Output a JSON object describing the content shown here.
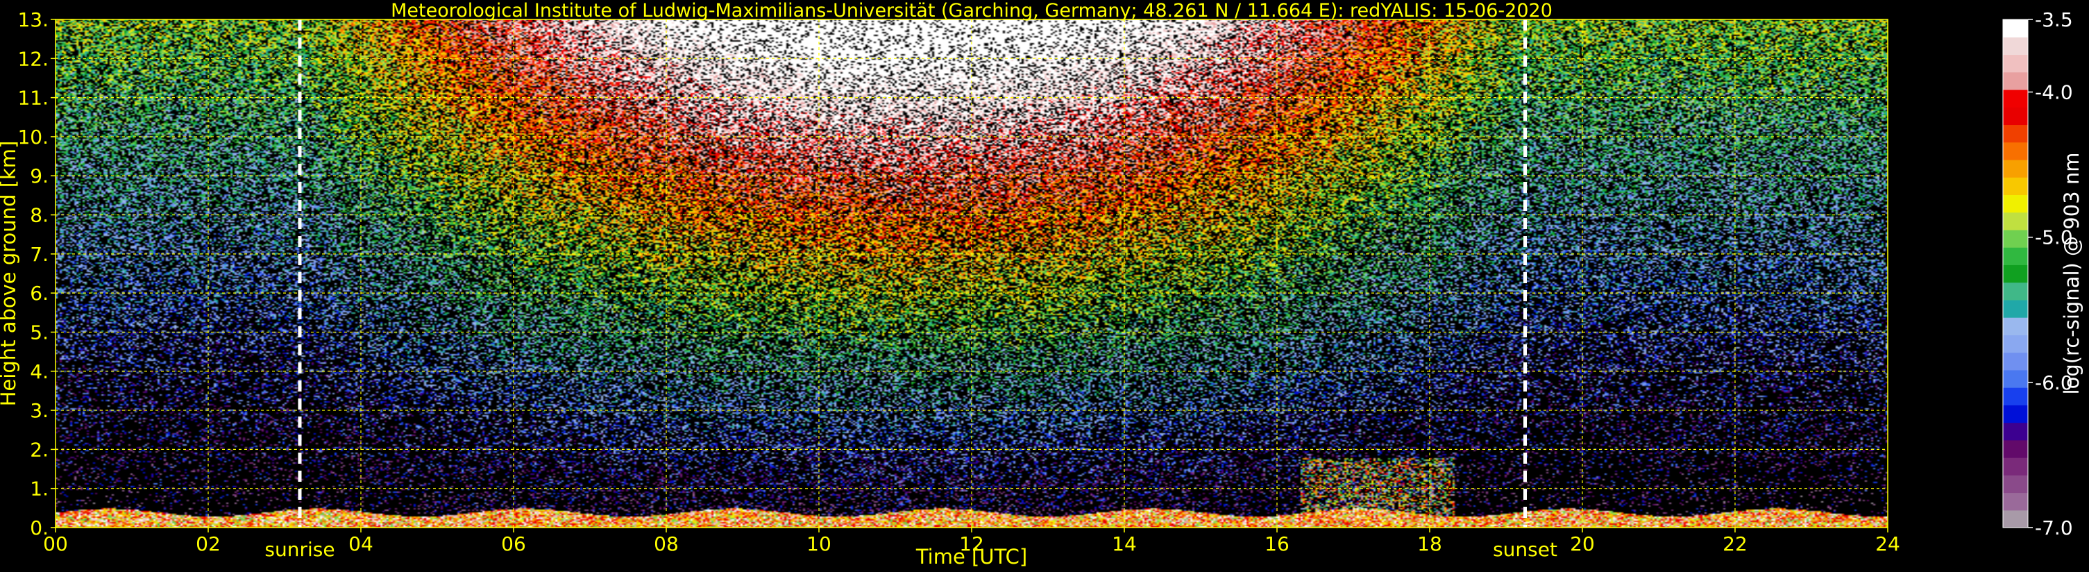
{
  "chart_data": {
    "type": "heatmap",
    "title": "Meteorological Institute of Ludwig-Maximilians-Universität (Garching, Germany; 48.261 N / 11.664 E):    redYALIS: 15-06-2020",
    "xlabel": "Time [UTC]",
    "ylabel": "Height above ground [km]",
    "xlim": [
      0,
      24
    ],
    "ylim": [
      0,
      13
    ],
    "x_ticks": [
      0,
      2,
      4,
      6,
      8,
      10,
      12,
      14,
      16,
      18,
      20,
      22,
      24
    ],
    "x_tick_labels": [
      "00",
      "02",
      "04",
      "06",
      "08",
      "10",
      "12",
      "14",
      "16",
      "18",
      "20",
      "22",
      "24"
    ],
    "y_ticks": [
      0,
      1,
      2,
      3,
      4,
      5,
      6,
      7,
      8,
      9,
      10,
      11,
      12,
      13
    ],
    "y_tick_labels": [
      "0.",
      "1.",
      "2.",
      "3.",
      "4.",
      "5.",
      "6.",
      "7.",
      "8.",
      "9.",
      "10.",
      "11.",
      "12.",
      "13."
    ],
    "grid": true,
    "events": [
      {
        "label": "sunrise",
        "x": 3.2
      },
      {
        "label": "sunset",
        "x": 19.25
      }
    ],
    "colorbar": {
      "label": "log(rc-signal) @ 903 nm",
      "range": [
        -7.0,
        -3.5
      ],
      "ticks": [
        -3.5,
        -4.0,
        -5.0,
        -6.0,
        -7.0
      ],
      "tick_labels": [
        "-3.5",
        "-4.0",
        "-5.0",
        "-6.0",
        "-7.0"
      ],
      "colors": [
        "#a89aa8",
        "#9a6a9a",
        "#8a4a8a",
        "#7a2a7a",
        "#620a6a",
        "#3c0090",
        "#0010d8",
        "#1840ee",
        "#4a78f0",
        "#7090f0",
        "#8aa8f0",
        "#9ab8ee",
        "#20a8a8",
        "#40b888",
        "#10a020",
        "#30b840",
        "#70d050",
        "#c0e040",
        "#f0f000",
        "#f8c800",
        "#f8a000",
        "#f87000",
        "#f04000",
        "#e80000",
        "#f00000",
        "#e8a0a0",
        "#f0c0c0",
        "#f0d8d8",
        "#ffffff"
      ]
    }
  },
  "colors": {
    "background": "#000000",
    "text": "#ffff00",
    "grid": "#ffff00",
    "markers": "#ffffff",
    "colorbar_text": "#ffffff"
  }
}
